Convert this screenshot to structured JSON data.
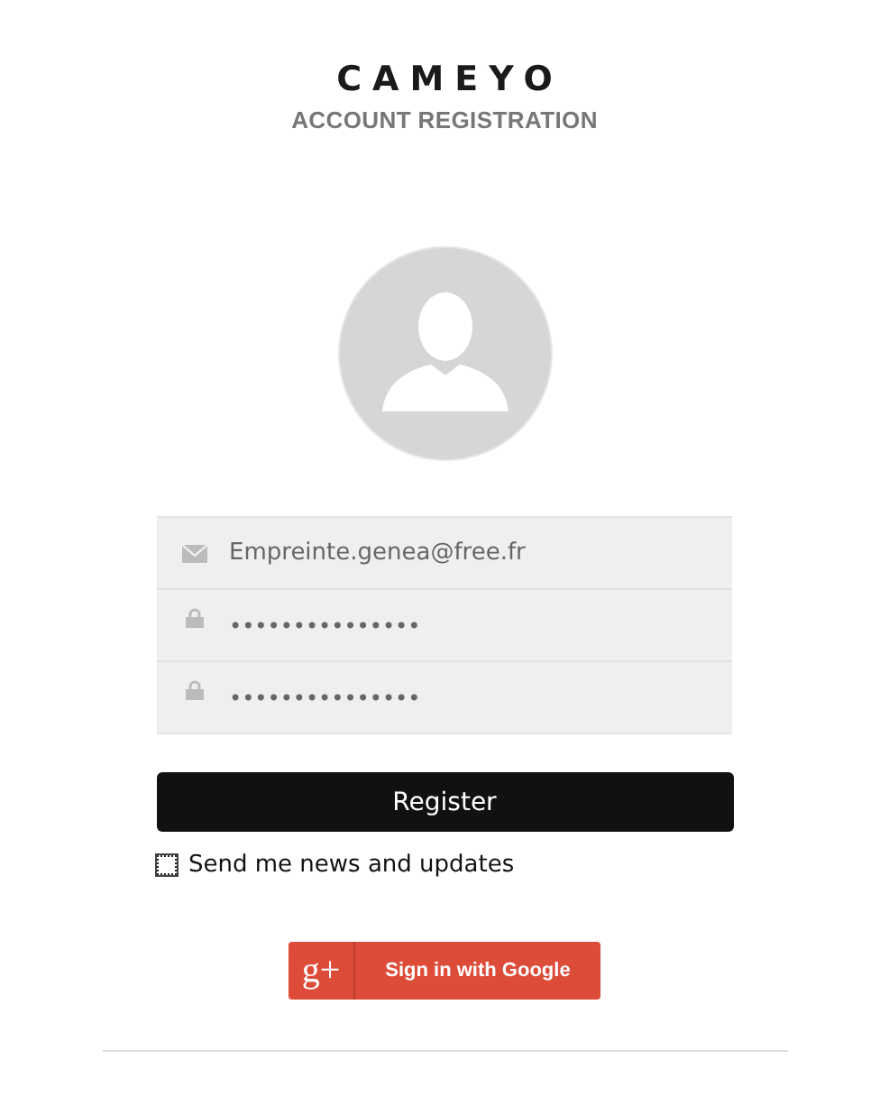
{
  "logo": "CAMEYO",
  "subtitle": "ACCOUNT REGISTRATION",
  "fields": [
    {
      "kind": "email",
      "value": "Empreinte.genea@free.fr"
    },
    {
      "kind": "password",
      "value": "•••••••••••••••"
    },
    {
      "kind": "password",
      "value": "•••••••••••••••"
    }
  ],
  "register_button": "Register",
  "newsletter": {
    "label": "Send me news and updates",
    "checked": false
  },
  "google_button": {
    "mark": "g+",
    "label": "Sign in with Google"
  }
}
